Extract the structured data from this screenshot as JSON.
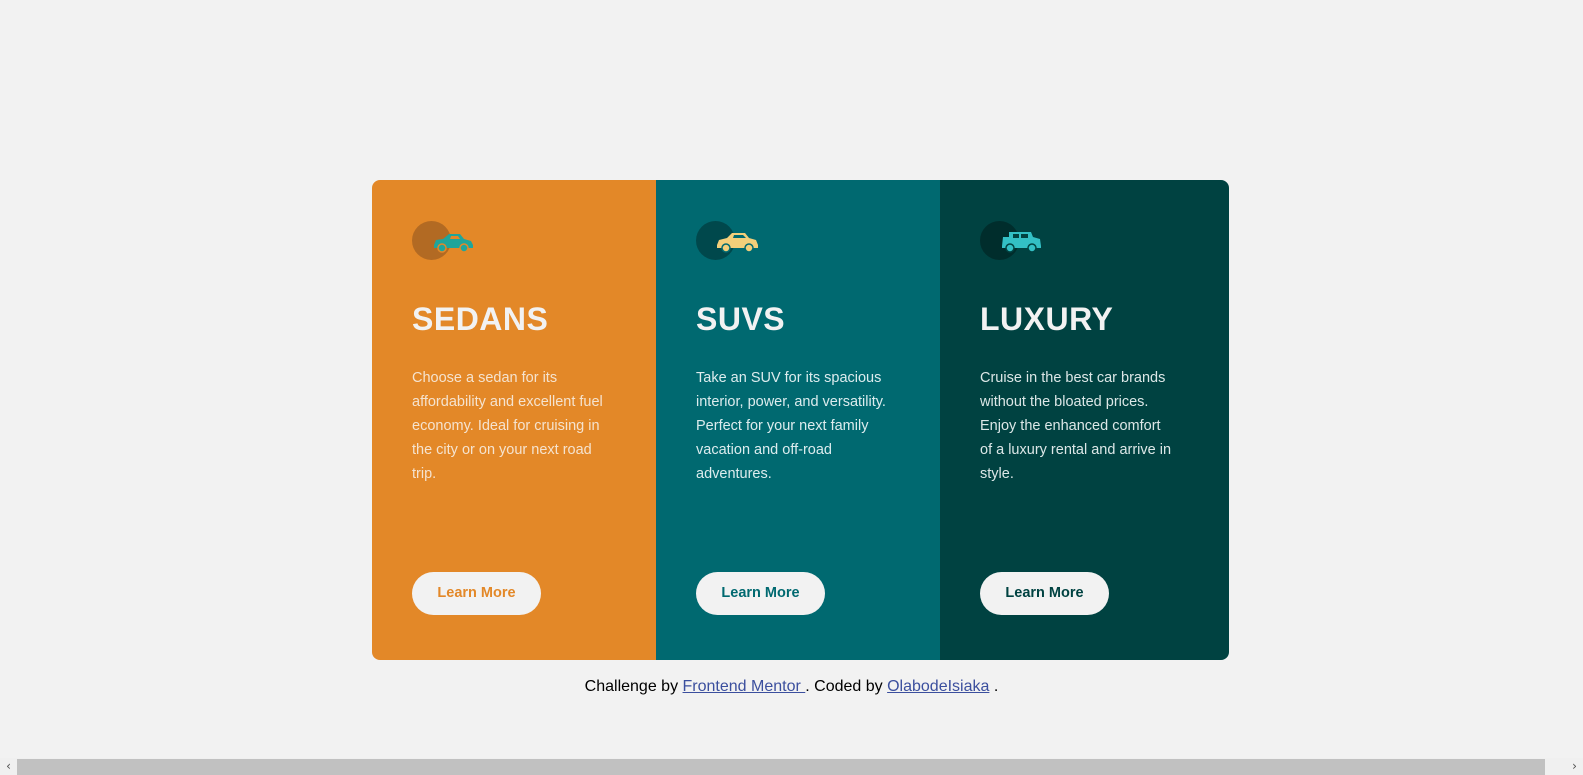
{
  "colors": {
    "page_bg": "#f2f2f2",
    "sedans_bg": "#e38828",
    "suvs_bg": "#006970",
    "luxury_bg": "#004241",
    "card_text": "#f2f2f2",
    "sedans_body_text": "#f5e3cf",
    "suvs_body_text": "#dcecee",
    "luxury_body_text": "#dce7e7",
    "link": "#3b4f9e"
  },
  "cards": [
    {
      "key": "sedans",
      "icon": "sedan-car-icon",
      "title": "SEDANS",
      "description": "Choose a sedan for its affordability and excellent fuel economy. Ideal for cruising in the city or on your next road trip.",
      "button_label": "Learn More"
    },
    {
      "key": "suvs",
      "icon": "suv-car-icon",
      "title": "SUVS",
      "description": "Take an SUV for its spacious interior, power, and versatility. Perfect for your next family vacation and off-road adventures.",
      "button_label": "Learn More"
    },
    {
      "key": "luxury",
      "icon": "luxury-car-icon",
      "title": "LUXURY",
      "description": "Cruise in the best car brands without the bloated prices. Enjoy the enhanced comfort of a luxury rental and arrive in style.",
      "button_label": "Learn More"
    }
  ],
  "footer": {
    "prefix": "Challenge by",
    "link1": "Frontend Mentor ",
    "middle": ". Coded by",
    "link2": "OlabodeIsiaka",
    "suffix": "."
  }
}
